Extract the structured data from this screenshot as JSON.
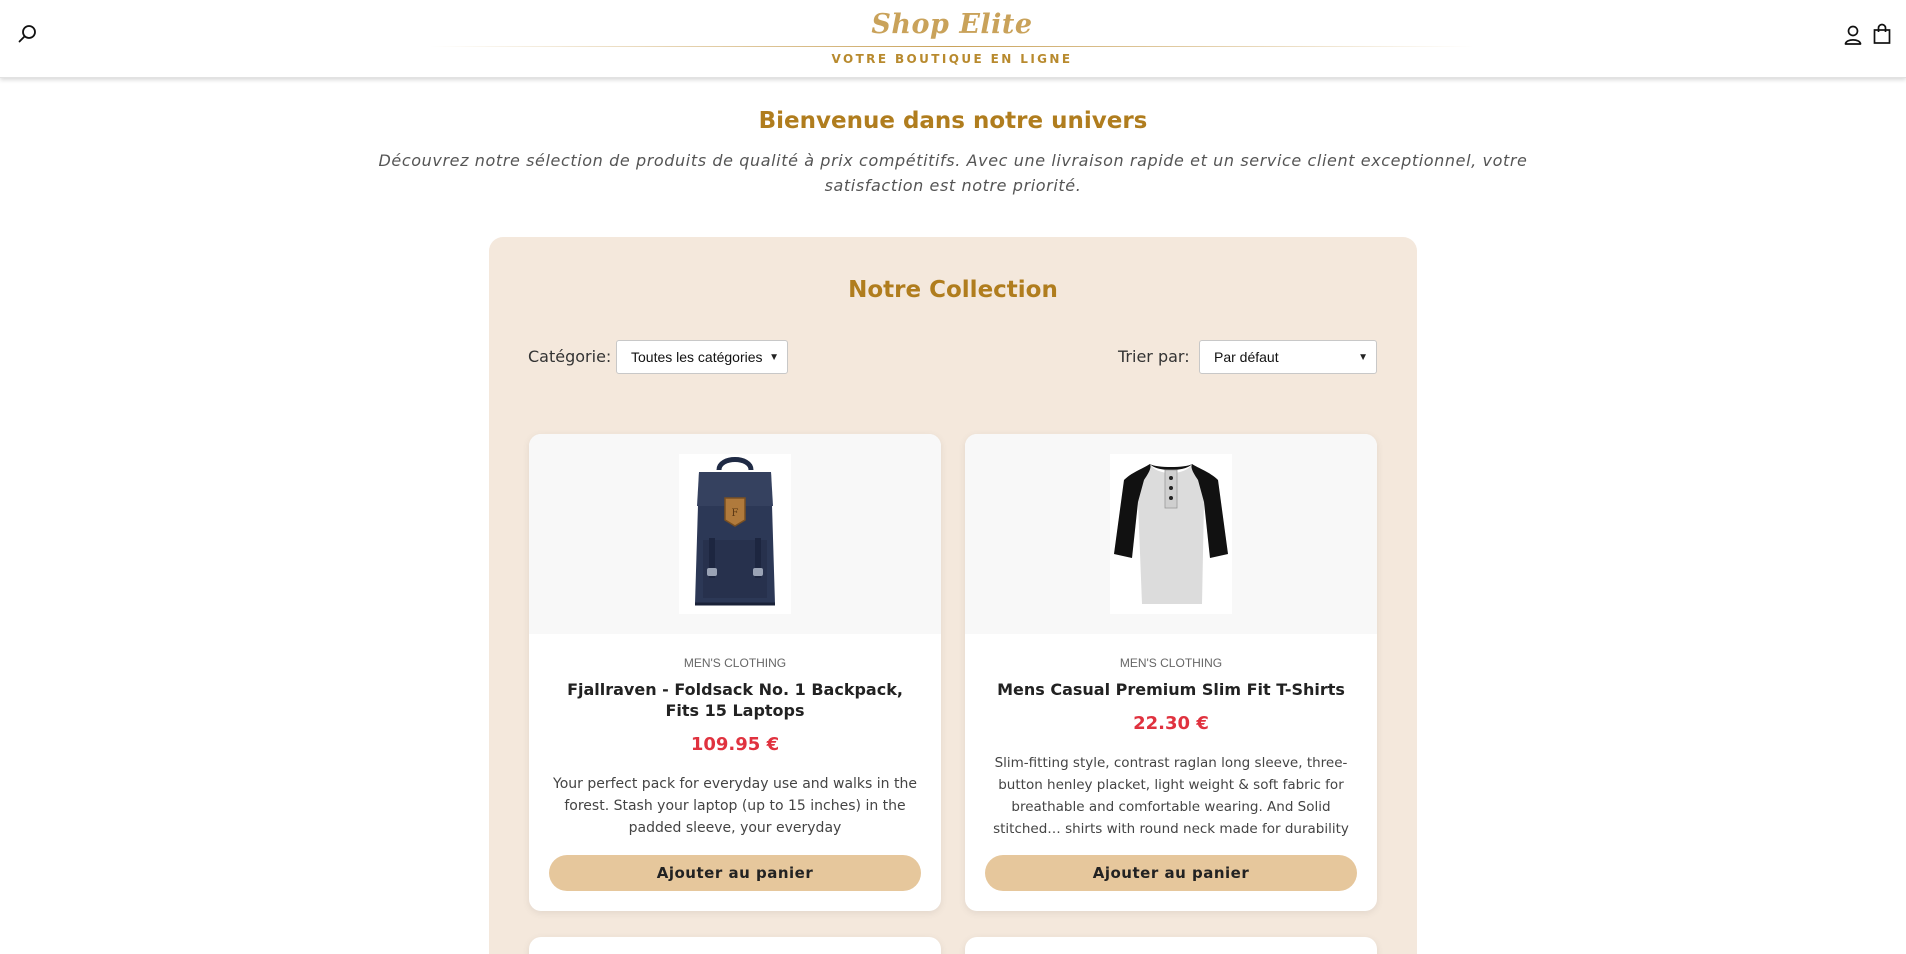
{
  "header": {
    "brand_name": "Shop Elite",
    "brand_tagline": "VOTRE BOUTIQUE EN LIGNE",
    "icons": [
      "search-icon",
      "user-icon",
      "shopping-bag-icon"
    ]
  },
  "welcome": {
    "title": "Bienvenue dans notre univers",
    "text_line1": "Découvrez notre sélection de produits de qualité à prix compétitifs. Avec une livraison rapide et un service client exceptionnel, votre",
    "text_line2": "satisfaction est notre priorité."
  },
  "collection": {
    "title": "Notre Collection",
    "category_label": "Catégorie:",
    "category_value": "Toutes les catégories",
    "sort_label": "Trier par:",
    "sort_value": "Par défaut"
  },
  "products": [
    {
      "category": "MEN'S CLOTHING",
      "title": "Fjallraven - Foldsack No. 1 Backpack, Fits 15 Laptops",
      "price": "109.95 €",
      "description": "Your perfect pack for everyday use and walks in the forest. Stash your laptop (up to 15 inches) in the padded sleeve, your everyday",
      "button": "Ajouter au panier",
      "image_icon": "backpack-image"
    },
    {
      "category": "MEN'S CLOTHING",
      "title": "Mens Casual Premium Slim Fit T-Shirts",
      "price": "22.30 €",
      "description": "Slim-fitting style, contrast raglan long sleeve, three-button henley placket, light weight & soft fabric for breathable and comfortable wearing. And Solid stitched… shirts with round neck made for durability and a great fit",
      "button": "Ajouter au panier",
      "image_icon": "tshirt-image"
    }
  ],
  "colors": {
    "accent_gold": "#b07d1e",
    "panel_bg": "#f4e8dc",
    "price_red": "#e0323f",
    "button_bg": "#e6c79c"
  }
}
